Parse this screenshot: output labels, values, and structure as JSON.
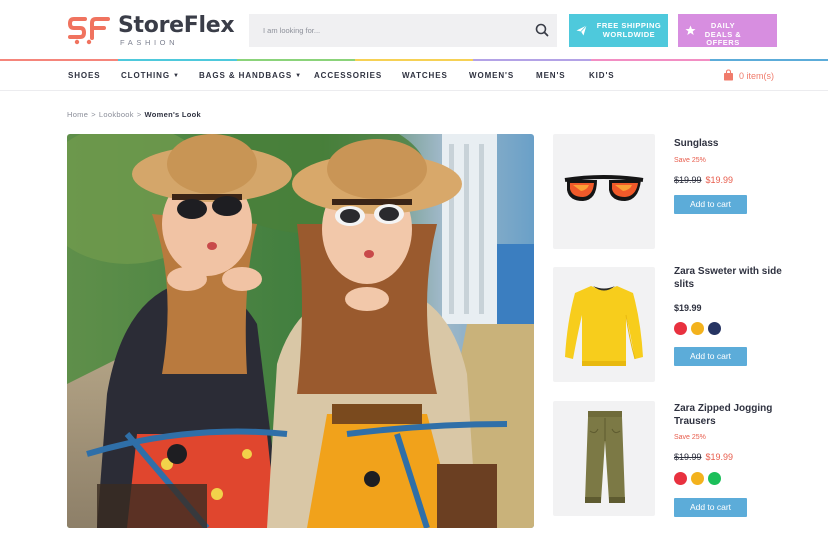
{
  "brand": {
    "name": "StoreFlex",
    "tagline": "FASHION",
    "mark_letters": "SF"
  },
  "search": {
    "placeholder": "I am looking for..."
  },
  "promos": [
    {
      "label": "FREE SHIPPING WORLDWIDE",
      "icon": "paper-plane-icon",
      "color": "#4ec9dc"
    },
    {
      "label": "DAILY DEALS & OFFERS",
      "icon": "star-icon",
      "color": "#d78ee0"
    }
  ],
  "strip_colors": [
    "#f5857b",
    "#4ec9dc",
    "#8bd37a",
    "#f6d155",
    "#b3a2e6",
    "#f28ec3",
    "#5cacd9"
  ],
  "nav": {
    "items": [
      {
        "label": "SHOES",
        "has_dropdown": false
      },
      {
        "label": "CLOTHING",
        "has_dropdown": true
      },
      {
        "label": "BAGS & HANDBAGS",
        "has_dropdown": true
      },
      {
        "label": "ACCESSORIES",
        "has_dropdown": false
      },
      {
        "label": "WATCHES",
        "has_dropdown": false
      },
      {
        "label": "WOMEN'S",
        "has_dropdown": false
      },
      {
        "label": "MEN'S",
        "has_dropdown": false
      },
      {
        "label": "KID'S",
        "has_dropdown": false
      }
    ],
    "cart_label": "0 item(s)"
  },
  "breadcrumb": {
    "items": [
      "Home",
      "Lookbook"
    ],
    "separator": ">",
    "current": "Women's Look"
  },
  "products": [
    {
      "name": "Sunglass",
      "save": "Save 25%",
      "old_price": "$19.99",
      "price": "$19.99",
      "colors": [],
      "button": "Add to cart",
      "icon": "sunglasses-icon"
    },
    {
      "name": "Zara Ssweter with side slits",
      "save": "",
      "old_price": "",
      "price": "$19.99",
      "colors": [
        "#e8313f",
        "#f3b21d",
        "#263462"
      ],
      "button": "Add to cart",
      "icon": "sweater-icon"
    },
    {
      "name": "Zara Zipped Jogging Trausers",
      "save": "Save 25%",
      "old_price": "$19.99",
      "price": "$19.99",
      "colors": [
        "#e8313f",
        "#f3b21d",
        "#1cbf5a"
      ],
      "button": "Add to cart",
      "icon": "trousers-icon"
    }
  ],
  "colors": {
    "accent_red": "#e85d4d",
    "button_blue": "#5cacd9",
    "cart_coral": "#f07b6b"
  }
}
